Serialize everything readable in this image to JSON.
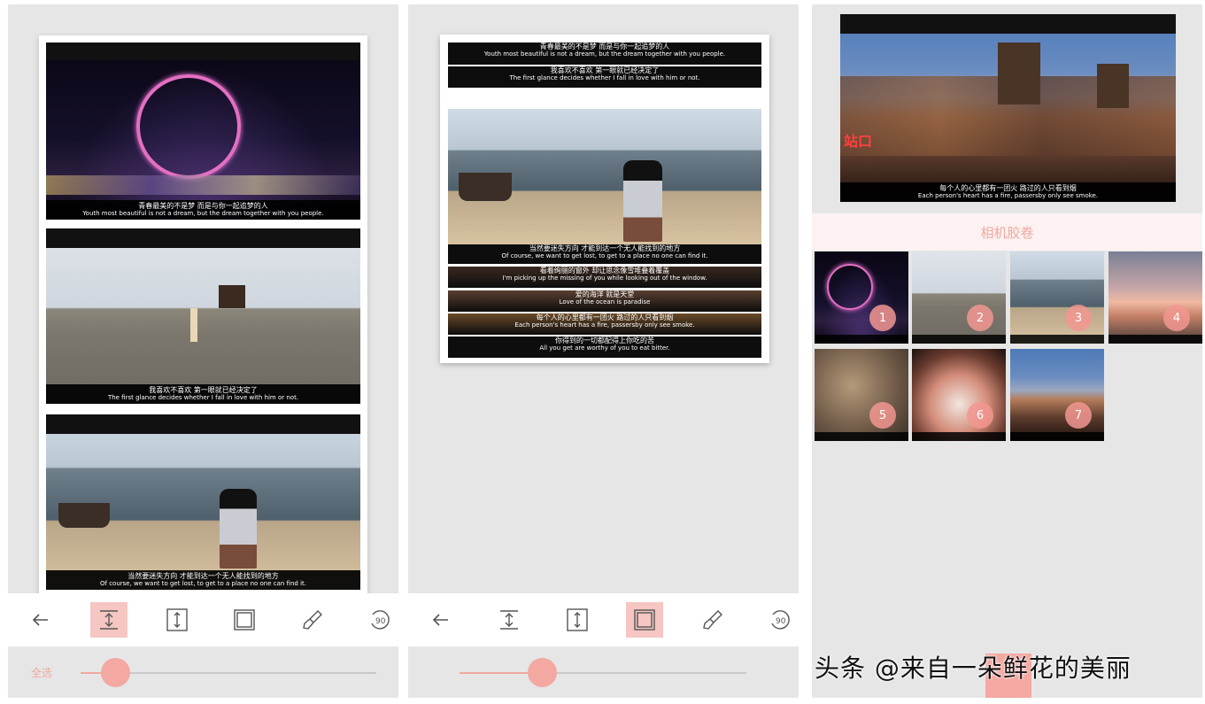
{
  "panel1": {
    "frames": [
      {
        "zh": "青春最美的不是梦 而是与你一起追梦的人",
        "en": "Youth most beautiful is not a dream, but the dream together with you people."
      },
      {
        "zh": "我喜欢不喜欢 第一眼就已经决定了",
        "en": "The first glance decides whether I fall in love with him or not."
      },
      {
        "zh": "当然要迷失方向 才能到达一个无人能找到的地方",
        "en": "Of course, we want to get lost, to get to a place no one can find it."
      }
    ],
    "slider": {
      "label": "全选",
      "value": 0.1
    }
  },
  "panel2": {
    "strips_top": [
      {
        "zh": "青春最美的不是梦 而是与你一起追梦的人",
        "en": "Youth most beautiful is not a dream, but the dream together with you people."
      },
      {
        "zh": "我喜欢不喜欢 第一眼就已经决定了",
        "en": "The first glance decides whether I fall in love with him or not."
      }
    ],
    "strips_bottom": [
      {
        "zh": "当然要迷失方向 才能到达一个无人能找到的地方",
        "en": "Of course, we want to get lost, to get to a place no one can find it."
      },
      {
        "zh": "看着绚丽的窗外 却让思念像雪堆叠着覆盖",
        "en": "I'm picking up the missing of you while looking out of the window."
      },
      {
        "zh": "爱的海洋 就是天堂",
        "en": "Love of the ocean is paradise"
      },
      {
        "zh": "每个人的心里都有一团火 路过的人只看到烟",
        "en": "Each person's heart has a fire, passersby only see smoke."
      },
      {
        "zh": "你得到的一切都配得上你吃的苦",
        "en": "All you get are worthy of you to eat bitter."
      }
    ],
    "slider": {
      "value": 0.25
    }
  },
  "panel3": {
    "preview": {
      "zh": "每个人的心里都有一团火 路过的人只看到烟",
      "en": "Each person's heart has a fire, passersby only see smoke."
    },
    "album_title": "相机胶卷",
    "thumbs": [
      "1",
      "2",
      "3",
      "4",
      "5",
      "6",
      "7"
    ],
    "sign_text": "站口"
  },
  "toolbar_icons": [
    "back-arrow-icon",
    "compress-spacing-icon",
    "expand-spacing-icon",
    "frame-border-icon",
    "brush-icon",
    "rotate-90-icon"
  ],
  "rotate_label": "90",
  "watermark": "头条 @来自一朵鲜花的美丽"
}
